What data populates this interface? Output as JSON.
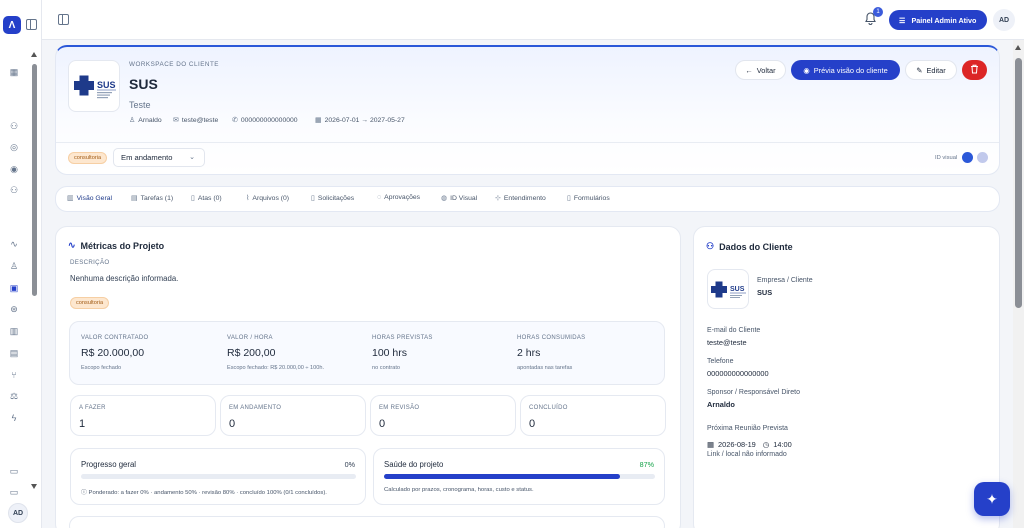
{
  "app": {
    "logo_letter": "Λ",
    "user_initials": "AD"
  },
  "topbar": {
    "notifications_count": "1",
    "admin_button": "Painel Admin Ativo",
    "avatar_initials": "AD"
  },
  "header": {
    "eyebrow": "WORKSPACE DO CLIENTE",
    "title": "SUS",
    "subtitle": "Teste",
    "meta": {
      "person": "Arnaldo",
      "email": "teste@teste",
      "phone": "000000000000000",
      "dates": "2026-07-01 → 2027-05-27"
    },
    "buttons": {
      "back": "Voltar",
      "preview": "Prévia visão do cliente",
      "edit": "Editar"
    },
    "tag": "consultoria",
    "status_select": "Em andamento",
    "visual_id_label": "ID visual",
    "colors": {
      "primary": "#2b58d8",
      "secondary": "#c1c9ec"
    }
  },
  "tabs": [
    {
      "label": "Visão Geral",
      "icon": "chart-icon"
    },
    {
      "label": "Tarefas (1)",
      "icon": "list-icon"
    },
    {
      "label": "Atas (0)",
      "icon": "document-icon"
    },
    {
      "label": "Arquivos (0)",
      "icon": "paperclip-icon"
    },
    {
      "label": "Solicitações",
      "icon": "clipboard-icon"
    },
    {
      "label": "Aprovações",
      "icon": "check-circle-icon"
    },
    {
      "label": "ID Visual",
      "icon": "palette-icon"
    },
    {
      "label": "Entendimento",
      "icon": "target-icon"
    },
    {
      "label": "Formulários",
      "icon": "form-icon"
    }
  ],
  "metrics": {
    "title": "Métricas do Projeto",
    "description_label": "DESCRIÇÃO",
    "description": "Nenhuma descrição informada.",
    "tag": "consultoria",
    "stats": [
      {
        "label": "VALOR CONTRATADO",
        "value": "R$ 20.000,00",
        "note": "Escopo fechado"
      },
      {
        "label": "VALOR / HORA",
        "value": "R$ 200,00",
        "note": "Escopo fechado: R$ 20.000,00 ÷ 100h."
      },
      {
        "label": "HORAS PREVISTAS",
        "value": "100 hrs",
        "note": "no contrato"
      },
      {
        "label": "HORAS CONSUMIDAS",
        "value": "2 hrs",
        "note": "apontadas nas tarefas"
      }
    ],
    "statuses": [
      {
        "label": "A FAZER",
        "value": "1"
      },
      {
        "label": "EM ANDAMENTO",
        "value": "0"
      },
      {
        "label": "EM REVISÃO",
        "value": "0"
      },
      {
        "label": "CONCLUÍDO",
        "value": "0"
      }
    ],
    "overall_progress": {
      "title": "Progresso geral",
      "percent_label": "0%",
      "value": 0,
      "note": "Ponderado: a fazer 0% · andamento 50% · revisão 80% · concluído 100% (0/1 concluídos)."
    },
    "project_health": {
      "title": "Saúde do projeto",
      "percent_label": "87%",
      "value": 0.87,
      "note": "Calculado por prazos, cronograma, horas, custo e status."
    }
  },
  "client": {
    "title": "Dados do Cliente",
    "company_label": "Empresa / Cliente",
    "company": "SUS",
    "email_label": "E-mail do Cliente",
    "email": "teste@teste",
    "phone_label": "Telefone",
    "phone": "000000000000000",
    "sponsor_label": "Sponsor / Responsável Direto",
    "sponsor": "Arnaldo",
    "meeting_label": "Próxima Reunião Prevista",
    "meeting_date": "2026-08-19",
    "meeting_time": "14:00",
    "meeting_link": "Link / local não informado"
  },
  "logo": {
    "text": "SUS",
    "tagline": "Sistema Único de Saúde"
  }
}
